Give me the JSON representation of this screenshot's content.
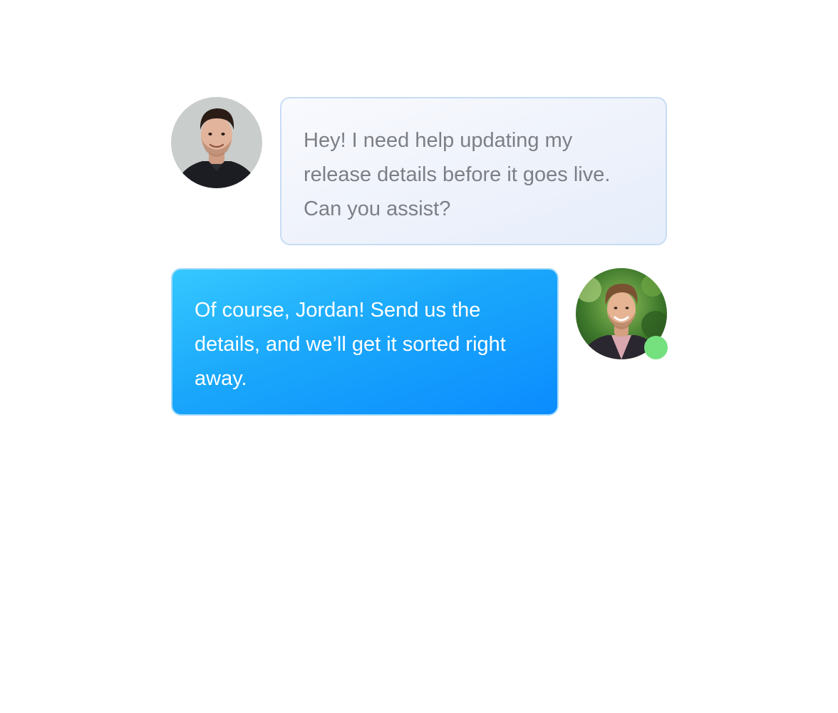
{
  "conversation": {
    "messages": [
      {
        "sender": "user",
        "avatar_icon": "user-photo-avatar",
        "text": "Hey! I need help updating my release details before it goes live. Can you assist?"
      },
      {
        "sender": "agent",
        "avatar_icon": "agent-photo-avatar",
        "online_status_icon": "online-status-dot",
        "text": "Of course, Jordan! Send us the details, and we’ll get it sorted right away."
      }
    ]
  },
  "colors": {
    "user_bubble_text": "#7d7f86",
    "user_bubble_border": "#c7dcf5",
    "agent_bubble_start": "#35c8ff",
    "agent_bubble_end": "#0b8cff",
    "online_dot": "#74e07e"
  }
}
